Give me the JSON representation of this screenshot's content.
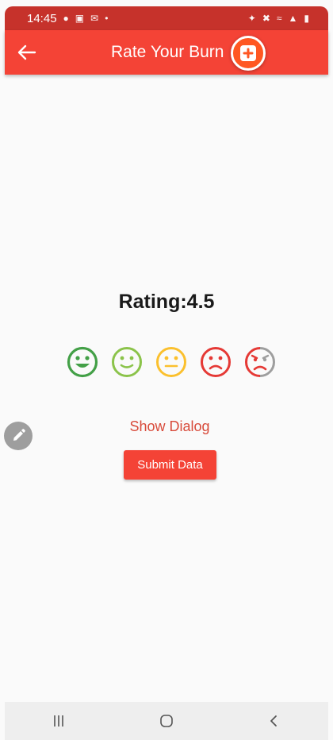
{
  "status_bar": {
    "time": "14:45",
    "left_icons": [
      "notification-icon",
      "image-icon",
      "mail-icon",
      "dot-icon"
    ],
    "right_icons": [
      "bluetooth-icon",
      "mute-icon",
      "wifi-icon",
      "signal-icon",
      "battery-icon"
    ]
  },
  "app_bar": {
    "title": "Rate Your Burn",
    "accent_color": "#f44336",
    "add_button_color": "#ff5722"
  },
  "rating": {
    "label": "Rating:4.5",
    "faces": [
      {
        "name": "very-happy-face-icon",
        "color": "#43a047"
      },
      {
        "name": "happy-face-icon",
        "color": "#8bc34a"
      },
      {
        "name": "neutral-face-icon",
        "color": "#fbc02d"
      },
      {
        "name": "sad-face-icon",
        "color": "#e53935"
      },
      {
        "name": "very-sad-face-icon",
        "color": "#e53935"
      }
    ]
  },
  "actions": {
    "show_dialog": "Show Dialog",
    "submit": "Submit Data"
  }
}
